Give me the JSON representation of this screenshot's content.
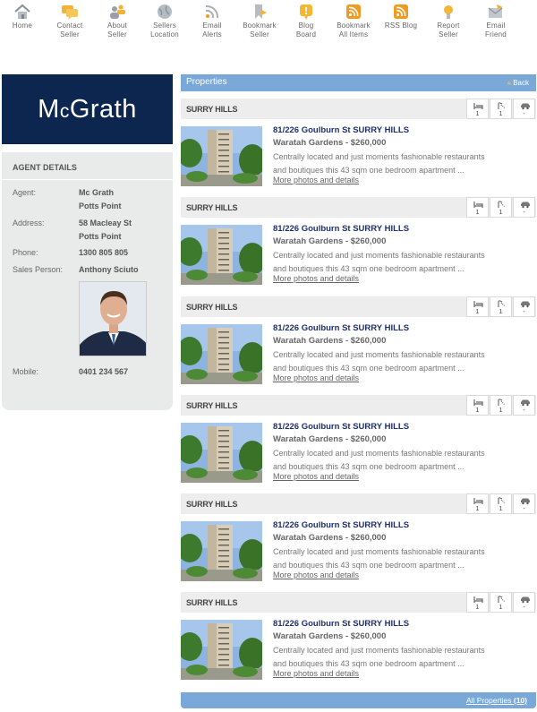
{
  "toolbar": [
    {
      "label1": "Home",
      "label2": "",
      "icon": "home-icon"
    },
    {
      "label1": "Contact",
      "label2": "Seller",
      "icon": "chat-bubble-icon"
    },
    {
      "label1": "About",
      "label2": "Seller",
      "icon": "people-icon"
    },
    {
      "label1": "Sellers",
      "label2": "Location",
      "icon": "globe-icon"
    },
    {
      "label1": "Email",
      "label2": "Alerts",
      "icon": "rss-icon"
    },
    {
      "label1": "Bookmark",
      "label2": "Seller",
      "icon": "bookmark-icon"
    },
    {
      "label1": "Blog",
      "label2": "Board",
      "icon": "blog-icon"
    },
    {
      "label1": "Bookmark",
      "label2": "All Items",
      "icon": "feed-icon"
    },
    {
      "label1": "RSS Blog",
      "label2": "",
      "icon": "feed-icon"
    },
    {
      "label1": "Report",
      "label2": "Seller",
      "icon": "report-icon"
    },
    {
      "label1": "Email",
      "label2": "Friend",
      "icon": "envelope-icon"
    }
  ],
  "logo": {
    "text_a": "M",
    "text_b": "c",
    "text_c": "Grath"
  },
  "agent": {
    "heading": "AGENT DETAILS",
    "agent_label": "Agent:",
    "agent_line1": "Mc Grath",
    "agent_line2": "Potts Point",
    "address_label": "Address:",
    "address_line1": "58 Macleay St",
    "address_line2": "Potts Point",
    "phone_label": "Phone:",
    "phone": "1300 805 805",
    "sales_label": "Sales Person:",
    "sales_person": "Anthony Sciuto",
    "mobile_label": "Mobile:",
    "mobile": "0401 234 567"
  },
  "properties": {
    "title": "Properties",
    "back": "Back",
    "all_label": "All Properties",
    "all_count": "(10)",
    "listings": [
      {
        "suburb": "SURRY HILLS",
        "beds": "1",
        "baths": "1",
        "cars": "-",
        "title": "81/226 Goulburn St SURRY HILLS",
        "sub": "Waratah Gardens - $260,000",
        "desc1": "Centrally located and just moments fashionable restaurants",
        "desc2": "and boutiques this 43 sqm one bedroom apartment ...",
        "more": "More photos and details"
      },
      {
        "suburb": "SURRY HILLS",
        "beds": "1",
        "baths": "1",
        "cars": "-",
        "title": "81/226 Goulburn St SURRY HILLS",
        "sub": "Waratah Gardens - $260,000",
        "desc1": "Centrally located and just moments fashionable restaurants",
        "desc2": "and boutiques this 43 sqm one bedroom apartment ...",
        "more": "More photos and details"
      },
      {
        "suburb": "SURRY HILLS",
        "beds": "1",
        "baths": "1",
        "cars": "-",
        "title": "81/226 Goulburn St SURRY HILLS",
        "sub": "Waratah Gardens - $260,000",
        "desc1": "Centrally located and just moments fashionable restaurants",
        "desc2": "and boutiques this 43 sqm one bedroom apartment ...",
        "more": "More photos and details"
      },
      {
        "suburb": "SURRY HILLS",
        "beds": "1",
        "baths": "1",
        "cars": "-",
        "title": "81/226 Goulburn St SURRY HILLS",
        "sub": "Waratah Gardens - $260,000",
        "desc1": "Centrally located and just moments fashionable restaurants",
        "desc2": "and boutiques this 43 sqm one bedroom apartment ...",
        "more": "More photos and details"
      },
      {
        "suburb": "SURRY HILLS",
        "beds": "1",
        "baths": "1",
        "cars": "-",
        "title": "81/226 Goulburn St SURRY HILLS",
        "sub": "Waratah Gardens - $260,000",
        "desc1": "Centrally located and just moments fashionable restaurants",
        "desc2": "and boutiques this 43 sqm one bedroom apartment ...",
        "more": "More photos and details"
      },
      {
        "suburb": "SURRY HILLS",
        "beds": "1",
        "baths": "1",
        "cars": "-",
        "title": "81/226 Goulburn St SURRY HILLS",
        "sub": "Waratah Gardens - $260,000",
        "desc1": "Centrally located and just moments fashionable restaurants",
        "desc2": "and boutiques this 43 sqm one bedroom apartment ...",
        "more": "More photos and details"
      }
    ]
  },
  "colors": {
    "brand_navy": "#0c2650",
    "header_blue": "#7aa8d8",
    "link_navy": "#1e2f6e",
    "panel_grey": "#e9eaea"
  }
}
